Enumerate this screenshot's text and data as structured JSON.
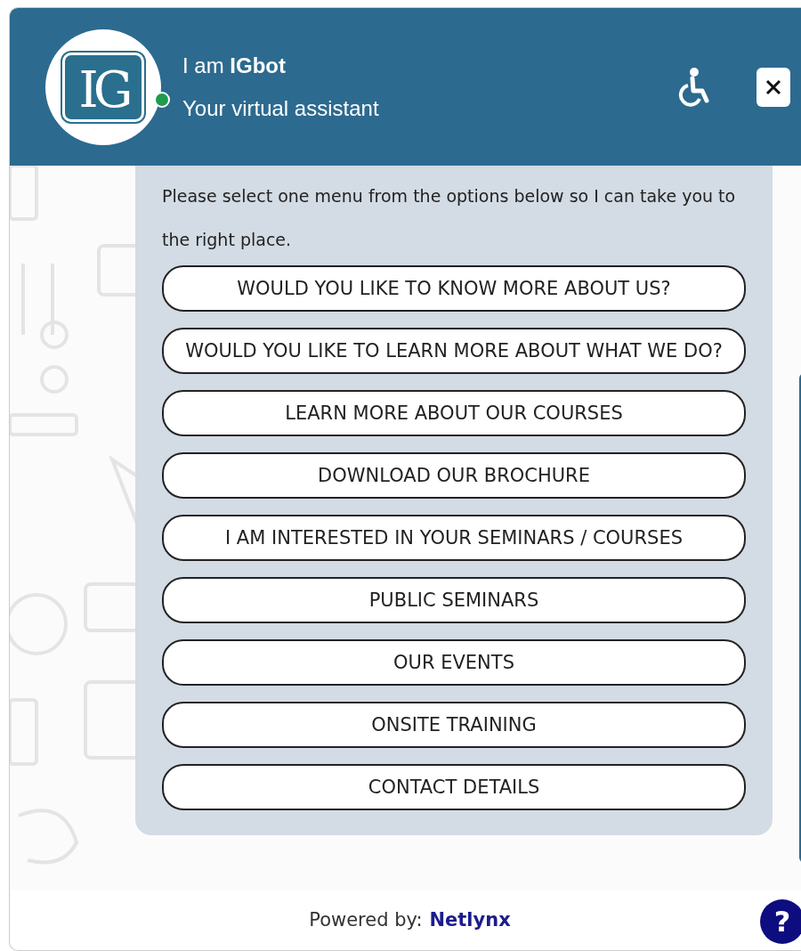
{
  "header": {
    "logo_text": "IG",
    "online": true,
    "title": "I am **IGbot**",
    "subtitle": "Your virtual assistant"
  },
  "message": {
    "text": "Please select one menu from the options below so I can take you to the right place.",
    "options": [
      "WOULD YOU LIKE TO KNOW MORE ABOUT US?",
      "WOULD YOU LIKE TO LEARN MORE ABOUT WHAT WE DO?",
      "LEARN MORE ABOUT OUR COURSES",
      "DOWNLOAD OUR BROCHURE",
      "I AM INTERESTED IN YOUR SEMINARS / COURSES",
      "PUBLIC SEMINARS",
      "OUR EVENTS",
      "ONSITE TRAINING",
      "CONTACT DETAILS"
    ]
  },
  "footer": {
    "label": "Powered by:",
    "brand": "Netlynx",
    "help": "?"
  }
}
